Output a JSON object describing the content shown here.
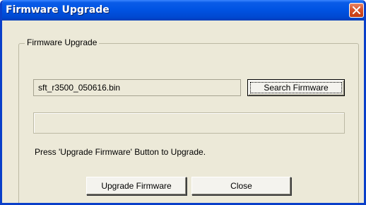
{
  "window": {
    "title": "Firmware Upgrade"
  },
  "group": {
    "label": "Firmware Upgrade"
  },
  "file": {
    "value": "sft_r3500_050616.bin"
  },
  "buttons": {
    "search": "Search Firmware",
    "upgrade": "Upgrade Firmware",
    "close": "Close"
  },
  "progress": {
    "fraction": 0
  },
  "status": {
    "message": "Press 'Upgrade Firmware' Button to Upgrade."
  },
  "colors": {
    "titlebar_blue": "#0054e3",
    "dialog_face": "#ece9d8",
    "close_red": "#d9532c",
    "progress_green": "#3a9e3a"
  },
  "icons": {
    "close": "close-icon"
  }
}
